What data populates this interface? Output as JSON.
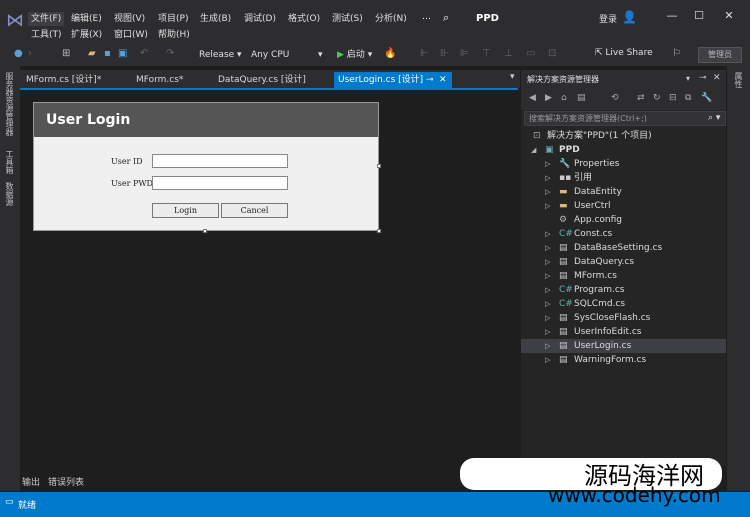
{
  "menu": {
    "row1": [
      "文件(F)",
      "编辑(E)",
      "视图(V)",
      "项目(P)",
      "生成(B)",
      "调试(D)",
      "格式(O)",
      "测试(S)",
      "分析(N)"
    ],
    "row2": [
      "工具(T)",
      "扩展(X)",
      "窗口(W)",
      "帮助(H)"
    ],
    "more": "…",
    "project_title": "PPD",
    "login": "登录"
  },
  "toolbar": {
    "configuration": "Release",
    "platform": "Any CPU",
    "start": "启动",
    "live_share": "Live Share",
    "admin": "管理员"
  },
  "left_strip": [
    "服务器资源管理器",
    "工具箱",
    "数据源"
  ],
  "right_strip": [
    "属性"
  ],
  "doc_tabs": [
    {
      "label": "MForm.cs [设计]*"
    },
    {
      "label": "MForm.cs*"
    },
    {
      "label": "DataQuery.cs [设计]"
    },
    {
      "label": "UserLogin.cs [设计]",
      "active": true
    }
  ],
  "form": {
    "title": "User Login",
    "user_id_label": "User ID",
    "user_pwd_label": "User PWD",
    "login_button": "Login",
    "cancel_button": "Cancel"
  },
  "solution_explorer": {
    "title": "解决方案资源管理器",
    "search_placeholder": "搜索解决方案资源管理器(Ctrl+;)",
    "items": [
      {
        "label": "解决方案\"PPD\"(1 个项目)",
        "icon": "solution-icon"
      },
      {
        "label": "PPD",
        "icon": "csharp-project-icon"
      },
      {
        "label": "Properties",
        "icon": "wrench-icon"
      },
      {
        "label": "引用",
        "icon": "references-icon"
      },
      {
        "label": "DataEntity",
        "icon": "folder-icon"
      },
      {
        "label": "UserCtrl",
        "icon": "folder-icon"
      },
      {
        "label": "App.config",
        "icon": "config-icon"
      },
      {
        "label": "Const.cs",
        "icon": "csharp-file-icon"
      },
      {
        "label": "DataBaseSetting.cs",
        "icon": "form-icon"
      },
      {
        "label": "DataQuery.cs",
        "icon": "form-icon"
      },
      {
        "label": "MForm.cs",
        "icon": "form-icon"
      },
      {
        "label": "Program.cs",
        "icon": "csharp-file-icon"
      },
      {
        "label": "SQLCmd.cs",
        "icon": "csharp-file-icon"
      },
      {
        "label": "SysCloseFlash.cs",
        "icon": "form-icon"
      },
      {
        "label": "UserInfoEdit.cs",
        "icon": "form-icon"
      },
      {
        "label": "UserLogin.cs",
        "icon": "form-icon",
        "selected": true
      },
      {
        "label": "WarningForm.cs",
        "icon": "form-icon"
      }
    ]
  },
  "bottom_tabs": [
    "输出",
    "错误列表"
  ],
  "status": "就绪",
  "watermark": {
    "line1": "源码海洋网",
    "line2": "www.codehy.com"
  },
  "colors": {
    "accent": "#007acc",
    "folder": "#dcb67a",
    "csharp": "#68b0ab"
  }
}
